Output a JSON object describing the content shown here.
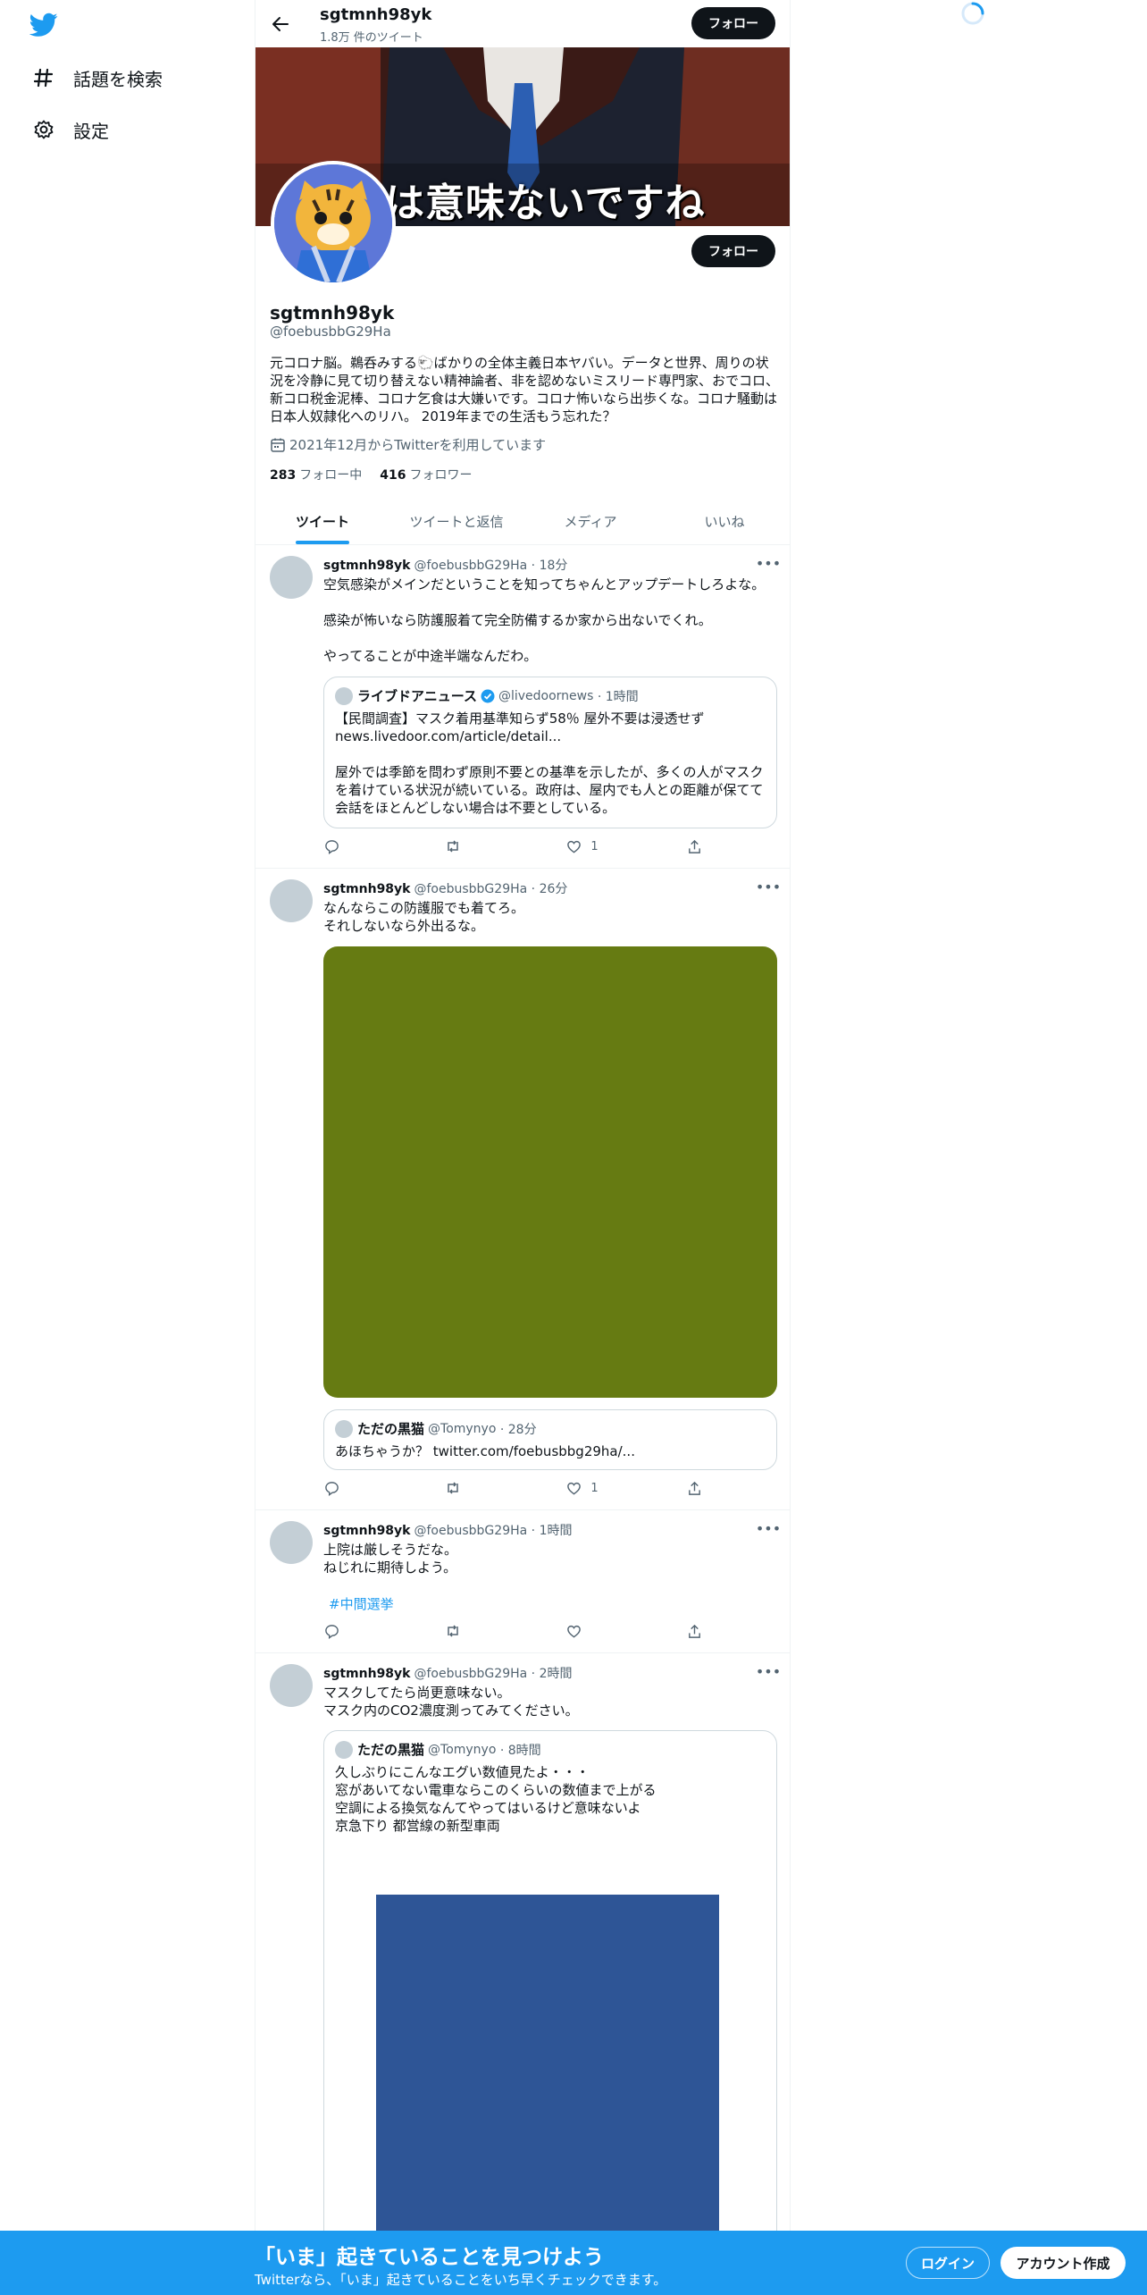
{
  "sidebar": {
    "logo": "twitter-bird-icon",
    "items": [
      {
        "icon": "hashtag-icon",
        "label": "話題を検索"
      },
      {
        "icon": "gear-icon",
        "label": "設定"
      }
    ]
  },
  "header": {
    "name": "sgtmnh98yk",
    "tweet_count": "1.8万 件のツイート",
    "follow_label": "フォロー"
  },
  "banner": {
    "overlay_text": "クは意味ないですね"
  },
  "profile": {
    "name": "sgtmnh98yk",
    "handle": "@foebusbbG29Ha",
    "follow_label": "フォロー",
    "bio": "元コロナ脳。鵜呑みする🐑ばかりの全体主義日本ヤバい。データと世界、周りの状況を冷静に見て切り替えない精神論者、非を認めないミスリード専門家、おでコロ、新コロ税金泥棒、コロナ乞食は大嫌いです。コロナ怖いなら出歩くな。コロナ騒動は日本人奴隷化へのリハ。 2019年までの生活もう忘れた？",
    "joined": "2021年12月からTwitterを利用しています",
    "following_count": "283",
    "following_label": "フォロー中",
    "followers_count": "416",
    "followers_label": "フォロワー"
  },
  "tabs": [
    {
      "label": "ツイート",
      "active": true
    },
    {
      "label": "ツイートと返信",
      "active": false
    },
    {
      "label": "メディア",
      "active": false
    },
    {
      "label": "いいね",
      "active": false
    }
  ],
  "tweets": [
    {
      "name": "sgtmnh98yk",
      "handle": "@foebusbbG29Ha",
      "time": "· 18分",
      "text": "空気感染がメインだということを知ってちゃんとアップデートしろよな。\n\n感染が怖いなら防護服着て完全防備するか家から出ないでくれ。\n\nやってることが中途半端なんだわ。",
      "quote": {
        "name": "ライブドアニュース",
        "handle": "@livedoornews",
        "time": "· 1時間",
        "text": "【民間調査】マスク着用基準知らず58％ 屋外不要は浸透せず\nnews.livedoor.com/article/detail...\n\n屋外では季節を問わず原則不要との基準を示したが、多くの人がマスクを着けている状況が続いている。政府は、屋内でも人との距離が保てて会話をほとんどしない場合は不要としている。"
      },
      "likes": "1"
    },
    {
      "name": "sgtmnh98yk",
      "handle": "@foebusbbG29Ha",
      "time": "· 26分",
      "text": "なんならこの防護服でも着てろ。\nそれしないなら外出るな。",
      "media_color": "#667b12",
      "quote": {
        "name": "ただの黒猫",
        "handle": "@Tomynyo",
        "time": "· 28分",
        "text": "あほちゃうか？ twitter.com/foebusbbg29ha/..."
      },
      "likes": "1"
    },
    {
      "name": "sgtmnh98yk",
      "handle": "@foebusbbG29Ha",
      "time": "· 1時間",
      "text": "上院は厳しそうだな。\nねじれに期待しよう。",
      "hashtag": "#中間選挙"
    },
    {
      "name": "sgtmnh98yk",
      "handle": "@foebusbbG29Ha",
      "time": "· 2時間",
      "text": "マスクしてたら尚更意味ない。\nマスク内のCO2濃度測ってみてください。",
      "quote": {
        "name": "ただの黒猫",
        "handle": "@Tomynyo",
        "time": "· 8時間",
        "text": "久しぶりにこんなエグい数値見たよ・・・\n窓があいてない電車ならこのくらいの数値まで上がる\n空調による換気なんてやってはいるけど意味ないよ\n京急下り 都営線の新型車両"
      },
      "media_color": "#2e5596"
    }
  ],
  "bottom_bar": {
    "title": "「いま」起きていることを見つけよう",
    "subtitle": "Twitterなら、「いま」起きていることをいち早くチェックできます。",
    "login": "ログイン",
    "signup": "アカウント作成"
  },
  "colors": {
    "accent": "#1d9bf0",
    "dark_button": "#0f1419",
    "secondary_text": "#536471"
  }
}
